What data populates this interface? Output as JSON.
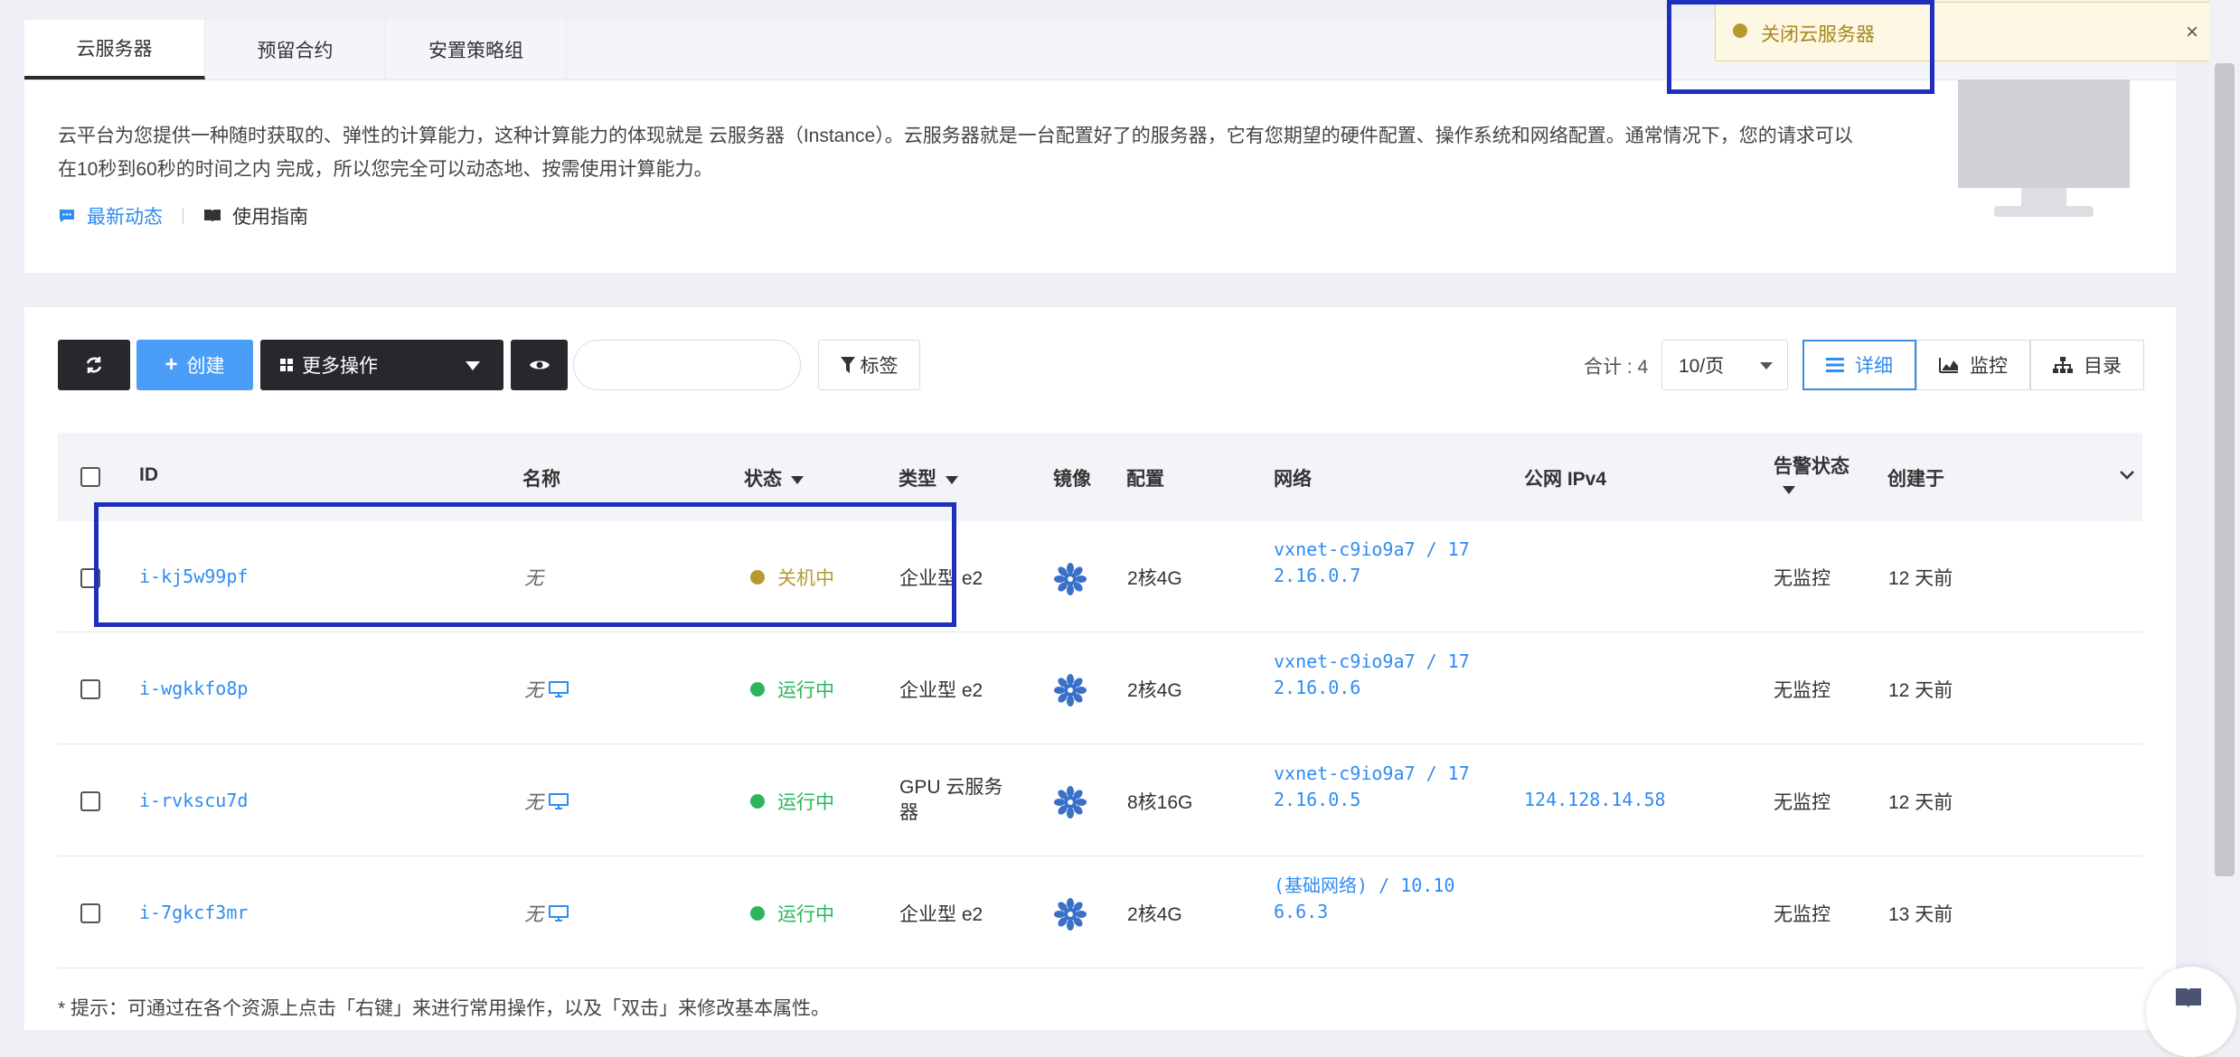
{
  "tabs": [
    "云服务器",
    "预留合约",
    "安置策略组"
  ],
  "intro": {
    "description": "云平台为您提供一种随时获取的、弹性的计算能力，这种计算能力的体现就是 云服务器（Instance）。云服务器就是一台配置好了的服务器，它有您期望的硬件配置、操作系统和网络配置。通常情况下，您的请求可以在10秒到60秒的时间之内 完成，所以您完全可以动态地、按需使用计算能力。",
    "latest_news": "最新动态",
    "user_guide": "使用指南"
  },
  "toast": {
    "message": "关闭云服务器",
    "close": "×"
  },
  "toolbar": {
    "create": "创建",
    "more_actions": "更多操作",
    "search_placeholder": "",
    "tag": "标签",
    "total": "合计 : 4",
    "page_size": "10/页",
    "views": [
      "详细",
      "监控",
      "目录"
    ]
  },
  "table": {
    "headers": {
      "id": "ID",
      "name": "名称",
      "status": "状态",
      "type": "类型",
      "image": "镜像",
      "config": "配置",
      "network": "网络",
      "public_ip": "公网 IPv4",
      "alarm": "告警状态",
      "created": "创建于"
    },
    "rows": [
      {
        "id": "i-kj5w99pf",
        "name": "无",
        "status": "关机中",
        "type": "企业型 e2",
        "config": "2核4G",
        "net1": "vxnet-c9io9a7 / 17",
        "net2": "2.16.0.7",
        "ip": "",
        "alarm": "无监控",
        "created": "12 天前"
      },
      {
        "id": "i-wgkkfo8p",
        "name": "无",
        "status": "运行中",
        "type": "企业型 e2",
        "config": "2核4G",
        "net1": "vxnet-c9io9a7 / 17",
        "net2": "2.16.0.6",
        "ip": "",
        "alarm": "无监控",
        "created": "12 天前"
      },
      {
        "id": "i-rvkscu7d",
        "name": "无",
        "status": "运行中",
        "type": "GPU 云服务器",
        "type_line1": "GPU 云服务",
        "type_line2": "器",
        "config": "8核16G",
        "net1": "vxnet-c9io9a7 / 17",
        "net2": "2.16.0.5",
        "ip": "124.128.14.58",
        "alarm": "无监控",
        "created": "12 天前"
      },
      {
        "id": "i-7gkcf3mr",
        "name": "无",
        "status": "运行中",
        "type": "企业型 e2",
        "config": "2核4G",
        "net1": "(基础网络) / 10.10",
        "net2": "6.6.3",
        "ip": "",
        "alarm": "无监控",
        "created": "13 天前"
      }
    ]
  },
  "hint": "* 提示：可通过在各个资源上点击「右键」来进行常用操作，以及「双击」来修改基本属性。",
  "colors": {
    "accent": "#2f8cf0",
    "running": "#2db55d",
    "stopping": "#b79a2f",
    "highlight": "#1f2fbd"
  }
}
